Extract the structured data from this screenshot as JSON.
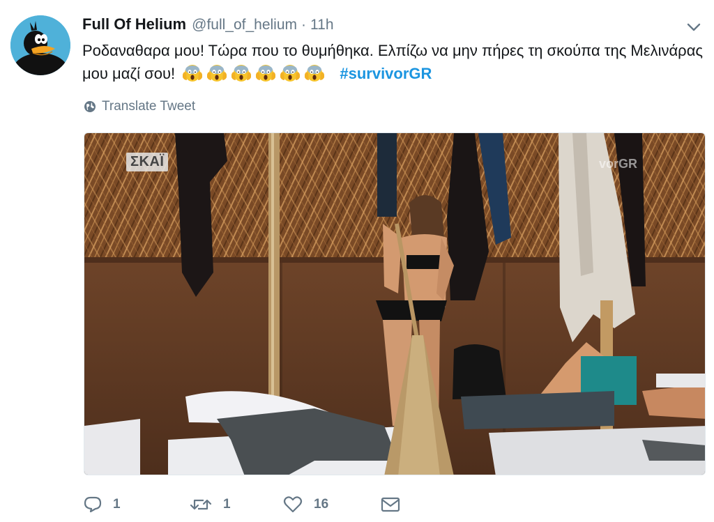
{
  "tweet": {
    "display_name": "Full Of Helium",
    "username": "@full_of_helium",
    "separator": "·",
    "time": "11h",
    "text_part1": "Ροδαναθαρα μου! Τώρα που το θυμήθηκα. Ελπίζω να μην πήρες τη σκούπα της Μελινάρας μου μαζί σου!",
    "emoji_name": "face-screaming-in-fear",
    "emoji_count": 6,
    "hashtag": "#survivorGR",
    "translate_label": "Translate Tweet"
  },
  "media": {
    "watermark": "ΣΚΑΪ",
    "watermark_right": "vorGR"
  },
  "actions": {
    "reply_count": "1",
    "retweet_count": "1",
    "like_count": "16"
  },
  "icons": {
    "caret": "chevron-down-icon",
    "globe": "globe-icon",
    "reply": "reply-icon",
    "retweet": "retweet-icon",
    "like": "heart-icon",
    "message": "envelope-icon"
  },
  "colors": {
    "link": "#1b95e0",
    "secondary": "#657786",
    "text": "#14171a"
  }
}
